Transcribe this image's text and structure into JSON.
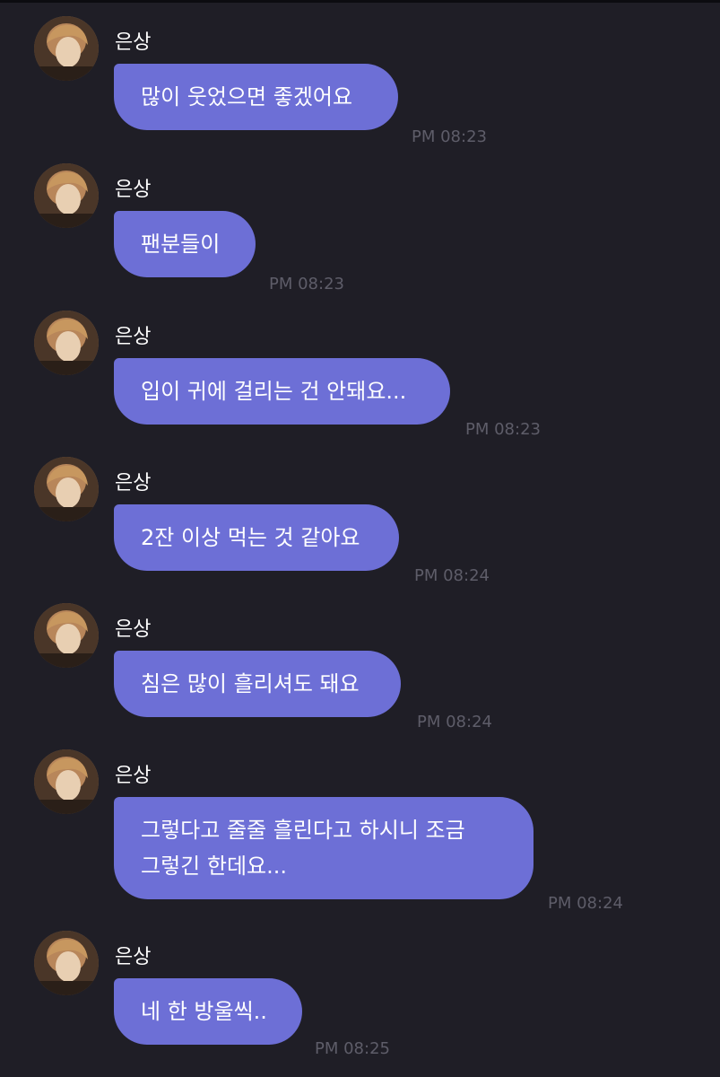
{
  "messages": [
    {
      "sender": "은상",
      "text": "많이 웃었으면 좋겠어요",
      "time": "PM 08:23"
    },
    {
      "sender": "은상",
      "text": "팬분들이",
      "time": "PM 08:23"
    },
    {
      "sender": "은상",
      "text": "입이 귀에 걸리는 건 안돼요...",
      "time": "PM 08:23"
    },
    {
      "sender": "은상",
      "text": "2잔 이상 먹는 것 같아요",
      "time": "PM 08:24"
    },
    {
      "sender": "은상",
      "text": "침은 많이 흘리셔도 돼요",
      "time": "PM 08:24"
    },
    {
      "sender": "은상",
      "text": "그렇다고 줄줄 흘린다고 하시니 조금\n그렇긴 한데요...",
      "time": "PM 08:24"
    },
    {
      "sender": "은상",
      "text": "네 한 방울씩..",
      "time": "PM 08:25"
    }
  ],
  "colors": {
    "background": "#1f1e26",
    "bubble": "#6d6fd6",
    "time_text": "#5e5d69",
    "text": "#ffffff"
  },
  "icons": {
    "avatar": "profile-photo"
  }
}
